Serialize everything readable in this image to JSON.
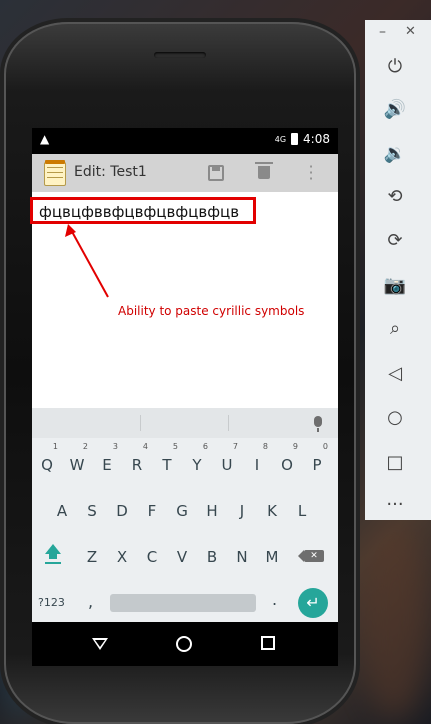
{
  "status_bar": {
    "warning_icon": "warning-triangle-icon",
    "network": "4G",
    "time": "4:08"
  },
  "action_bar": {
    "title": "Edit: Test1",
    "icons": [
      "notepad-icon",
      "save-icon",
      "delete-icon",
      "overflow-menu-icon"
    ]
  },
  "editor": {
    "text": "фцвцфввфцвфцвфцвфцв"
  },
  "annotation": {
    "text": "Ability to paste cyrillic symbols",
    "color": "#e20000"
  },
  "keyboard": {
    "row1": [
      {
        "label": "Q",
        "hint": "1"
      },
      {
        "label": "W",
        "hint": "2"
      },
      {
        "label": "E",
        "hint": "3"
      },
      {
        "label": "R",
        "hint": "4"
      },
      {
        "label": "T",
        "hint": "5"
      },
      {
        "label": "Y",
        "hint": "6"
      },
      {
        "label": "U",
        "hint": "7"
      },
      {
        "label": "I",
        "hint": "8"
      },
      {
        "label": "O",
        "hint": "9"
      },
      {
        "label": "P",
        "hint": "0"
      }
    ],
    "row2": [
      "A",
      "S",
      "D",
      "F",
      "G",
      "H",
      "J",
      "K",
      "L"
    ],
    "row3": [
      "Z",
      "X",
      "C",
      "V",
      "B",
      "N",
      "M"
    ],
    "symbols_label": "?123",
    "comma": ",",
    "period": ".",
    "accent_color": "#26a69a"
  },
  "emulator_panel": {
    "buttons": [
      "power-icon",
      "volume-up-icon",
      "volume-down-icon",
      "rotate-left-icon",
      "rotate-right-icon",
      "camera-icon",
      "zoom-icon",
      "back-icon",
      "home-icon",
      "overview-icon",
      "more-icon"
    ]
  }
}
